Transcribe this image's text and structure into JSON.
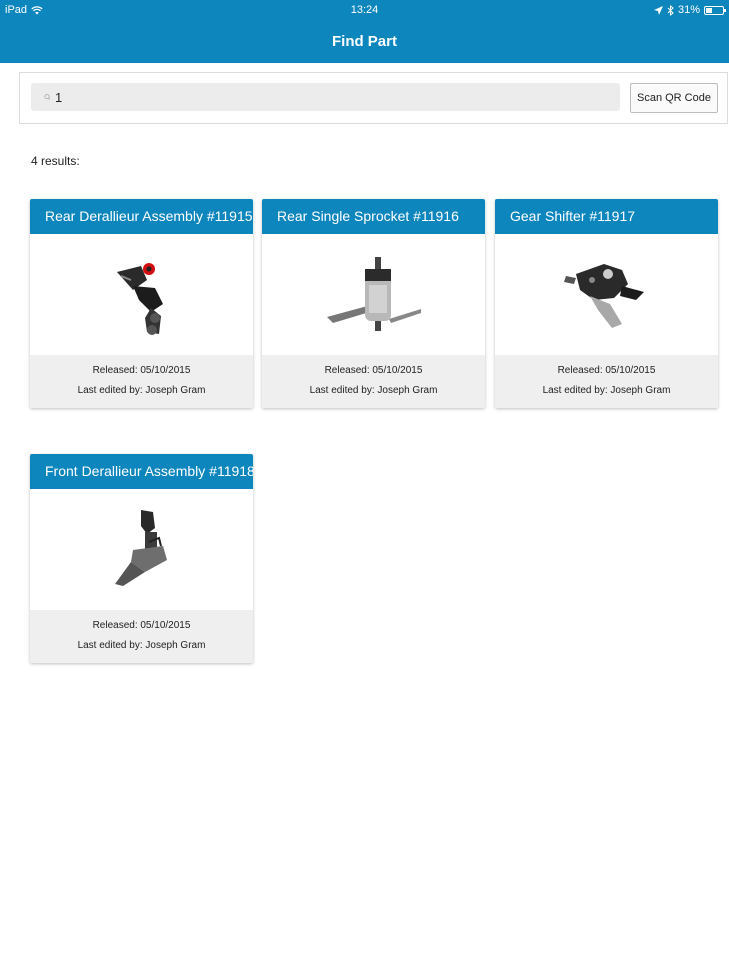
{
  "status": {
    "device": "iPad",
    "time": "13:24",
    "battery": "31%"
  },
  "nav": {
    "title": "Find Part"
  },
  "search": {
    "value": "1",
    "scan_label": "Scan QR Code"
  },
  "results": {
    "count_text": "4 results:",
    "cards": [
      {
        "title": "Rear Derallieur Assembly #11915",
        "released": "Released: 05/10/2015",
        "edited": "Last edited by: Joseph Gram",
        "image": "rear-derailleur-image"
      },
      {
        "title": "Rear Single Sprocket #11916",
        "released": "Released: 05/10/2015",
        "edited": "Last edited by: Joseph Gram",
        "image": "rear-hub-sprocket-image"
      },
      {
        "title": "Gear Shifter #11917",
        "released": "Released: 05/10/2015",
        "edited": "Last edited by: Joseph Gram",
        "image": "gear-shifter-image"
      },
      {
        "title": "Front Derallieur Assembly #11918",
        "released": "Released: 05/10/2015",
        "edited": "Last edited by: Joseph Gram",
        "image": "front-derailleur-image"
      }
    ]
  },
  "colors": {
    "accent": "#0d86be",
    "footer_bg": "#efefef"
  }
}
